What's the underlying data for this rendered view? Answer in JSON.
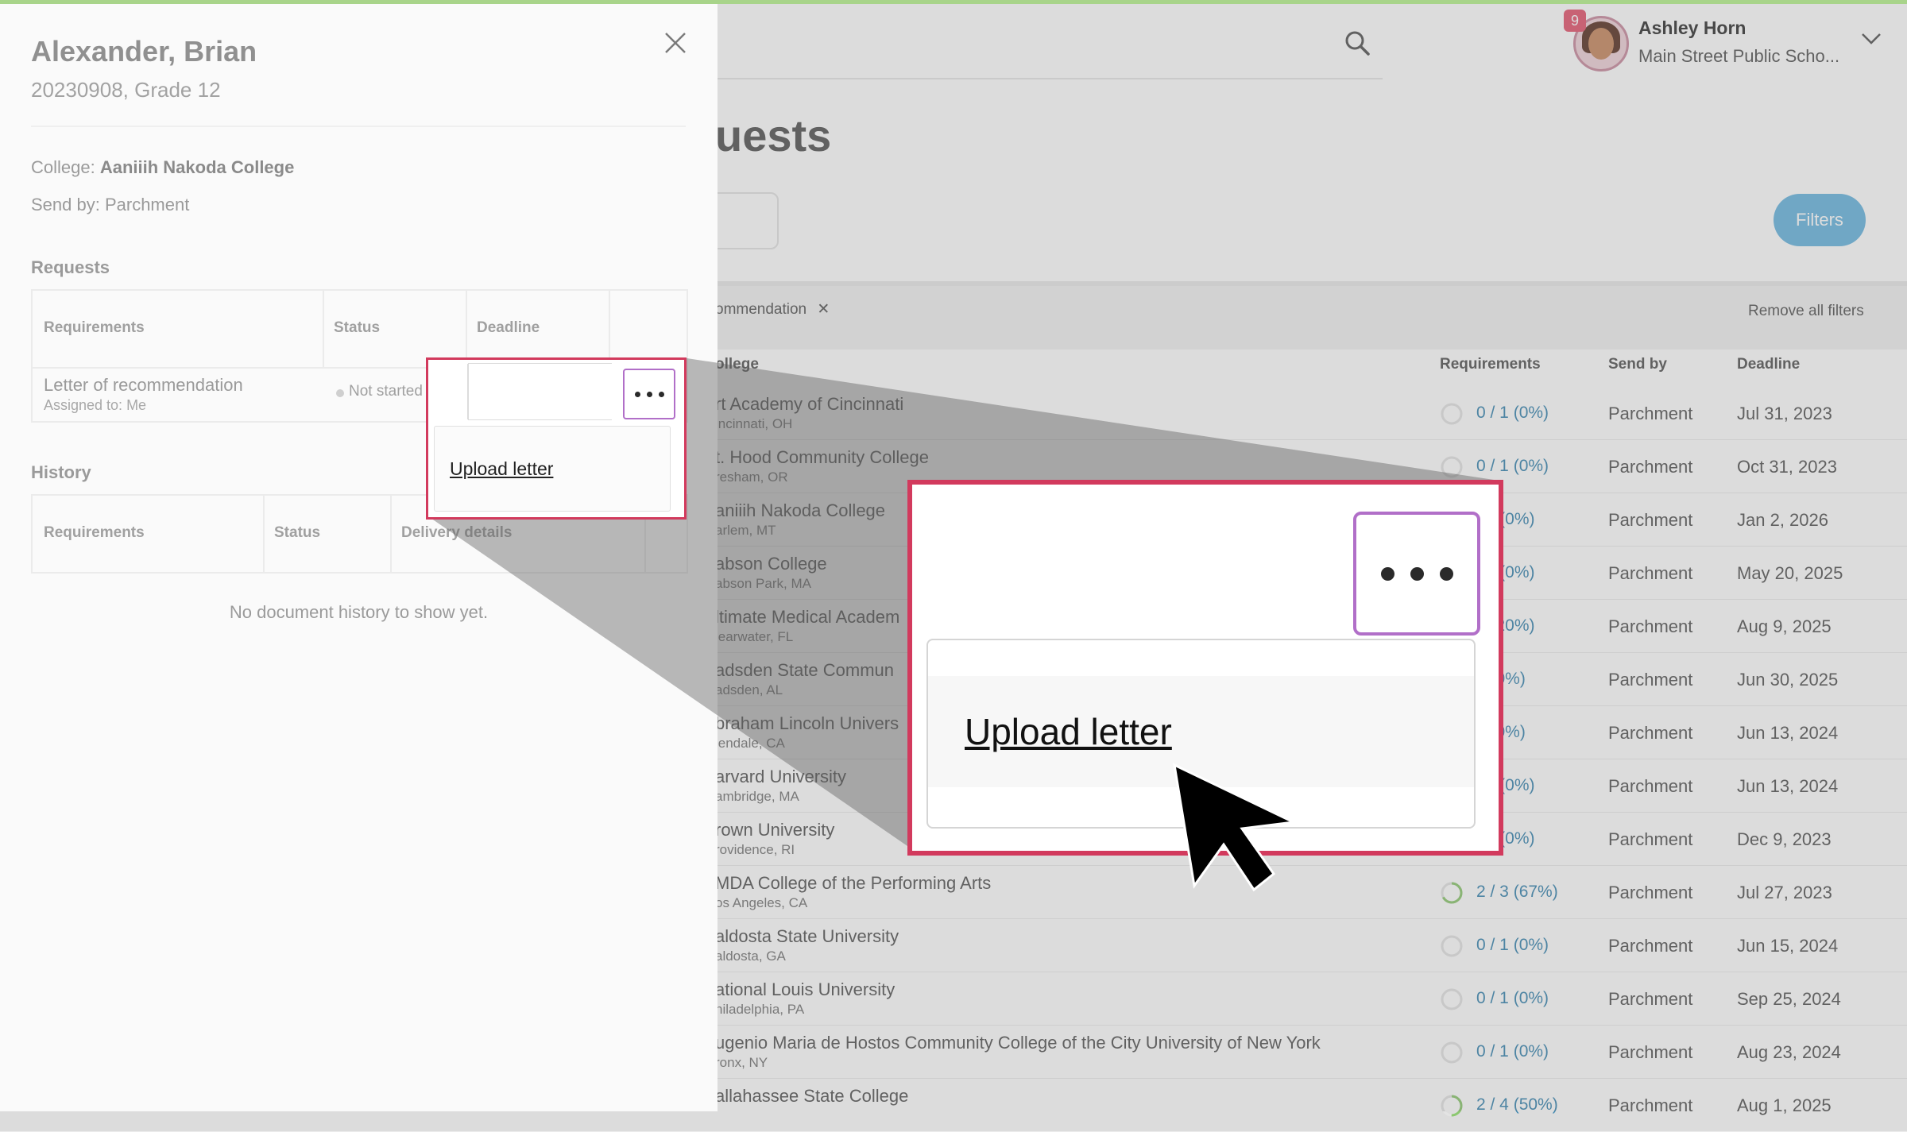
{
  "user": {
    "name": "Ashley Horn",
    "school": "Main Street Public Scho...",
    "notifications": "9"
  },
  "page": {
    "title": "uests",
    "filters_label": "Filters",
    "active_filter": "ommendation",
    "remove_all_filters": "Remove all filters"
  },
  "table": {
    "headers": {
      "college": "ollege",
      "requirements": "Requirements",
      "send_by": "Send by",
      "deadline": "Deadline"
    },
    "rows": [
      {
        "name": "rt Academy of Cincinnati",
        "location": "incinnati, OH",
        "req": "0 / 1 (0%)",
        "progress": 0,
        "send_by": "Parchment",
        "deadline": "Jul 31, 2023"
      },
      {
        "name": "t. Hood Community College",
        "location": "resham, OR",
        "req": "0 / 1 (0%)",
        "progress": 0,
        "send_by": "Parchment",
        "deadline": "Oct 31, 2023"
      },
      {
        "name": "aniiih Nakoda College",
        "location": "arlem, MT",
        "req": "/ 1 (0%)",
        "progress": 0,
        "send_by": "Parchment",
        "deadline": "Jan 2, 2026"
      },
      {
        "name": "abson College",
        "location": "abson Park, MA",
        "req": "/ 1 (0%)",
        "progress": 0,
        "send_by": "Parchment",
        "deadline": "May 20, 2025"
      },
      {
        "name": "ltimate Medical Academ",
        "location": "learwater, FL",
        "req": "5 (20%)",
        "progress": 0.2,
        "send_by": "Parchment",
        "deadline": "Aug 9, 2025"
      },
      {
        "name": "adsden State Commun",
        "location": "adsden, AL",
        "req": "2 (0%)",
        "progress": 0,
        "send_by": "Parchment",
        "deadline": "Jun 30, 2025"
      },
      {
        "name": "braham Lincoln Univers",
        "location": "lendale, CA",
        "req": "4 (0%)",
        "progress": 0,
        "send_by": "Parchment",
        "deadline": "Jun 13, 2024"
      },
      {
        "name": "arvard University",
        "location": "ambridge, MA",
        "req": "/ 1 (0%)",
        "progress": 0,
        "send_by": "Parchment",
        "deadline": "Jun 13, 2024"
      },
      {
        "name": "rown University",
        "location": "rovidence, RI",
        "req": "/ 1 (0%)",
        "progress": 0,
        "send_by": "Parchment",
        "deadline": "Dec 9, 2023"
      },
      {
        "name": "MDA College of the Performing Arts",
        "location": "os Angeles, CA",
        "req": "2 / 3 (67%)",
        "progress": 0.67,
        "send_by": "Parchment",
        "deadline": "Jul 27, 2023"
      },
      {
        "name": "aldosta State University",
        "location": "aldosta, GA",
        "req": "0 / 1 (0%)",
        "progress": 0,
        "send_by": "Parchment",
        "deadline": "Jun 15, 2024"
      },
      {
        "name": "ational Louis University",
        "location": "hiladelphia, PA",
        "req": "0 / 1 (0%)",
        "progress": 0,
        "send_by": "Parchment",
        "deadline": "Sep 25, 2024"
      },
      {
        "name": "ugenio Maria de Hostos Community College of the City University of New York",
        "location": "ronx, NY",
        "req": "0 / 1 (0%)",
        "progress": 0,
        "send_by": "Parchment",
        "deadline": "Aug 23, 2024"
      },
      {
        "name": "allahassee State College",
        "location": "",
        "req": "2 / 4 (50%)",
        "progress": 0.5,
        "send_by": "Parchment",
        "deadline": "Aug 1, 2025"
      }
    ]
  },
  "drawer": {
    "student_name": "Alexander, Brian",
    "student_id": "20230908, Grade 12",
    "college_label": "College: ",
    "college_value": "Aaniiih Nakoda College",
    "send_by": "Send by: Parchment",
    "requests_heading": "Requests",
    "requests_headers": {
      "requirements": "Requirements",
      "status": "Status",
      "deadline": "Deadline"
    },
    "request_item": {
      "name": "Letter of recommendation",
      "assigned": "Assigned to: Me",
      "status": "Not started"
    },
    "history_heading": "History",
    "history_headers": {
      "requirements": "Requirements",
      "status": "Status",
      "delivery": "Delivery details"
    },
    "empty_history": "No document history to show yet."
  },
  "menu": {
    "upload_letter": "Upload letter"
  },
  "colors": {
    "highlight_border": "#d23a5d",
    "kebab_border": "#b16fc8",
    "link": "#3a86b0",
    "progress": "#8cc870"
  }
}
